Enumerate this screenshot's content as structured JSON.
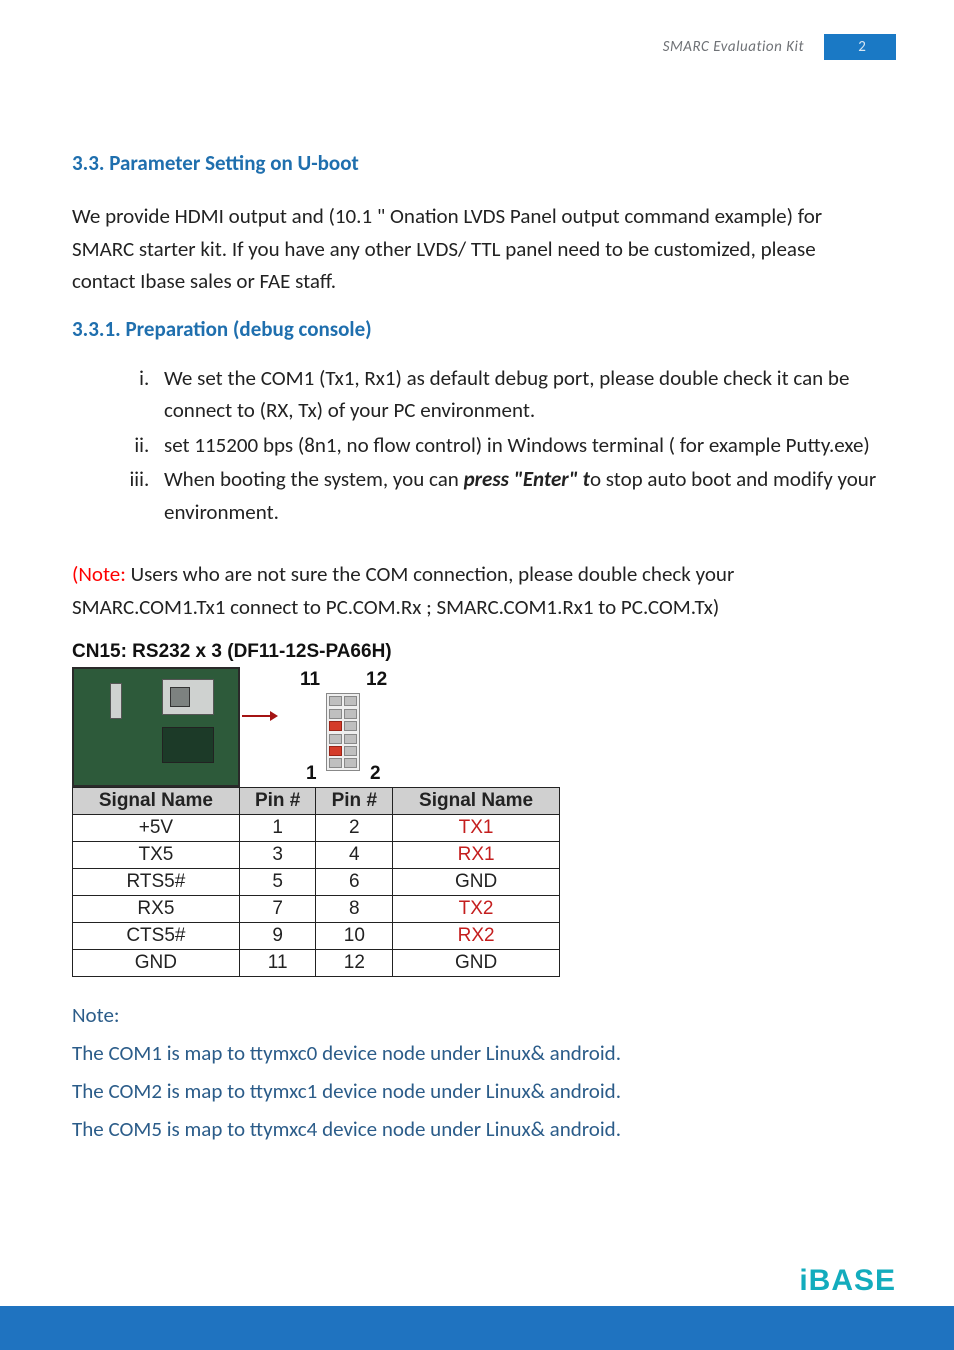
{
  "header": {
    "doc_title": "SMARC  Evaluation  Kit",
    "page_number": "2"
  },
  "sections": {
    "s33_title": "3.3.  Parameter Setting on U-boot",
    "intro_para": "We provide HDMI output and (10.1 \" Onation LVDS Panel output command example) for SMARC starter kit. If you have any other LVDS/ TTL panel need to be customized, please contact Ibase sales or FAE staff.",
    "s331_title": "3.3.1.  Preparation (debug console)",
    "list": {
      "i": "We set the COM1 (Tx1, Rx1) as default debug port, please double check it can be connect to (RX, Tx) of your PC environment.",
      "ii": "set 115200 bps (8n1, no flow control) in Windows terminal ( for example Putty.exe)",
      "iii_a": "When booting the system, you can ",
      "iii_b": "press \"Enter\" t",
      "iii_c": "o stop auto boot and modify your environment."
    },
    "note_prefix": "(Note: ",
    "note_body": "Users who are not sure the COM connection, please double check your SMARC.COM1.Tx1 connect to PC.COM.Rx ; SMARC.COM1.Rx1 to PC.COM.Tx)"
  },
  "figure": {
    "title": "CN15: RS232 x 3 (DF11-12S-PA66H)",
    "label_top_left": "11",
    "label_top_right": "12",
    "label_bot_left": "1",
    "label_bot_right": "2"
  },
  "table": {
    "headers": [
      "Signal Name",
      "Pin #",
      "Pin #",
      "Signal Name"
    ],
    "rows": [
      [
        "+5V",
        "1",
        "2",
        "TX1"
      ],
      [
        "TX5",
        "3",
        "4",
        "RX1"
      ],
      [
        "RTS5#",
        "5",
        "6",
        "GND"
      ],
      [
        "RX5",
        "7",
        "8",
        "TX2"
      ],
      [
        "CTS5#",
        "9",
        "10",
        "RX2"
      ],
      [
        "GND",
        "11",
        "12",
        "GND"
      ]
    ],
    "red_cells": [
      "TX1",
      "RX1",
      "TX2",
      "RX2"
    ]
  },
  "note2": {
    "line0": "Note:",
    "line1": "The COM1 is map to ttymxc0 device node under Linux& android.",
    "line2": "The COM2 is map to ttymxc1 device node under Linux& android.",
    "line3": "The COM5 is map to ttymxc4 device node under Linux& android."
  },
  "logo": "iBASE"
}
